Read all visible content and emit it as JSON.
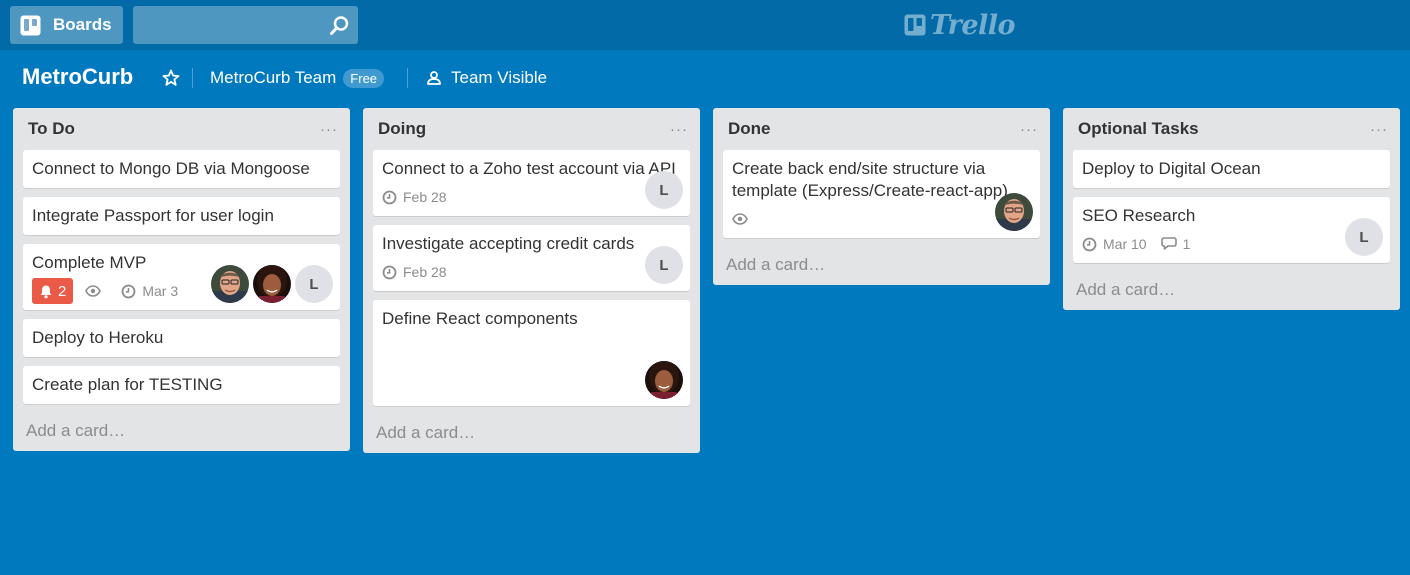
{
  "header": {
    "boards_label": "Boards",
    "search_value": "",
    "logo_text": "Trello"
  },
  "board": {
    "title": "MetroCurb",
    "team_name": "MetroCurb Team",
    "team_badge": "Free",
    "visibility": "Team Visible"
  },
  "colors": {
    "background": "#0079bf",
    "topbar": "#026aa7",
    "list": "#e2e4e6",
    "alert_badge": "#eb5a46"
  },
  "lists": [
    {
      "title": "To Do",
      "menu": "···",
      "add_card": "Add a card…",
      "cards": [
        {
          "title": "Connect to Mongo DB via Mongoose"
        },
        {
          "title": "Integrate Passport for user login"
        },
        {
          "title": "Complete MVP",
          "alert_count": "2",
          "watched": true,
          "due": "Mar 3",
          "members": [
            "photo-man",
            "photo-woman",
            "L"
          ]
        },
        {
          "title": "Deploy to Heroku"
        },
        {
          "title": "Create plan for TESTING"
        }
      ]
    },
    {
      "title": "Doing",
      "menu": "···",
      "add_card": "Add a card…",
      "cards": [
        {
          "title": "Connect to a Zoho test account via API",
          "due": "Feb 28",
          "members": [
            "L"
          ]
        },
        {
          "title": "Investigate accepting credit cards",
          "due": "Feb 28",
          "members": [
            "L"
          ]
        },
        {
          "title": "Define React components",
          "members": [
            "photo-woman"
          ]
        }
      ]
    },
    {
      "title": "Done",
      "menu": "···",
      "add_card": "Add a card…",
      "cards": [
        {
          "title": "Create back end/site structure via template (Express/Create-react-app)",
          "watched": true,
          "members": [
            "photo-man"
          ]
        }
      ]
    },
    {
      "title": "Optional Tasks",
      "menu": "···",
      "add_card": "Add a card…",
      "cards": [
        {
          "title": "Deploy to Digital Ocean"
        },
        {
          "title": "SEO Research",
          "due": "Mar 10",
          "comments": "1",
          "members": [
            "L"
          ]
        }
      ]
    }
  ]
}
